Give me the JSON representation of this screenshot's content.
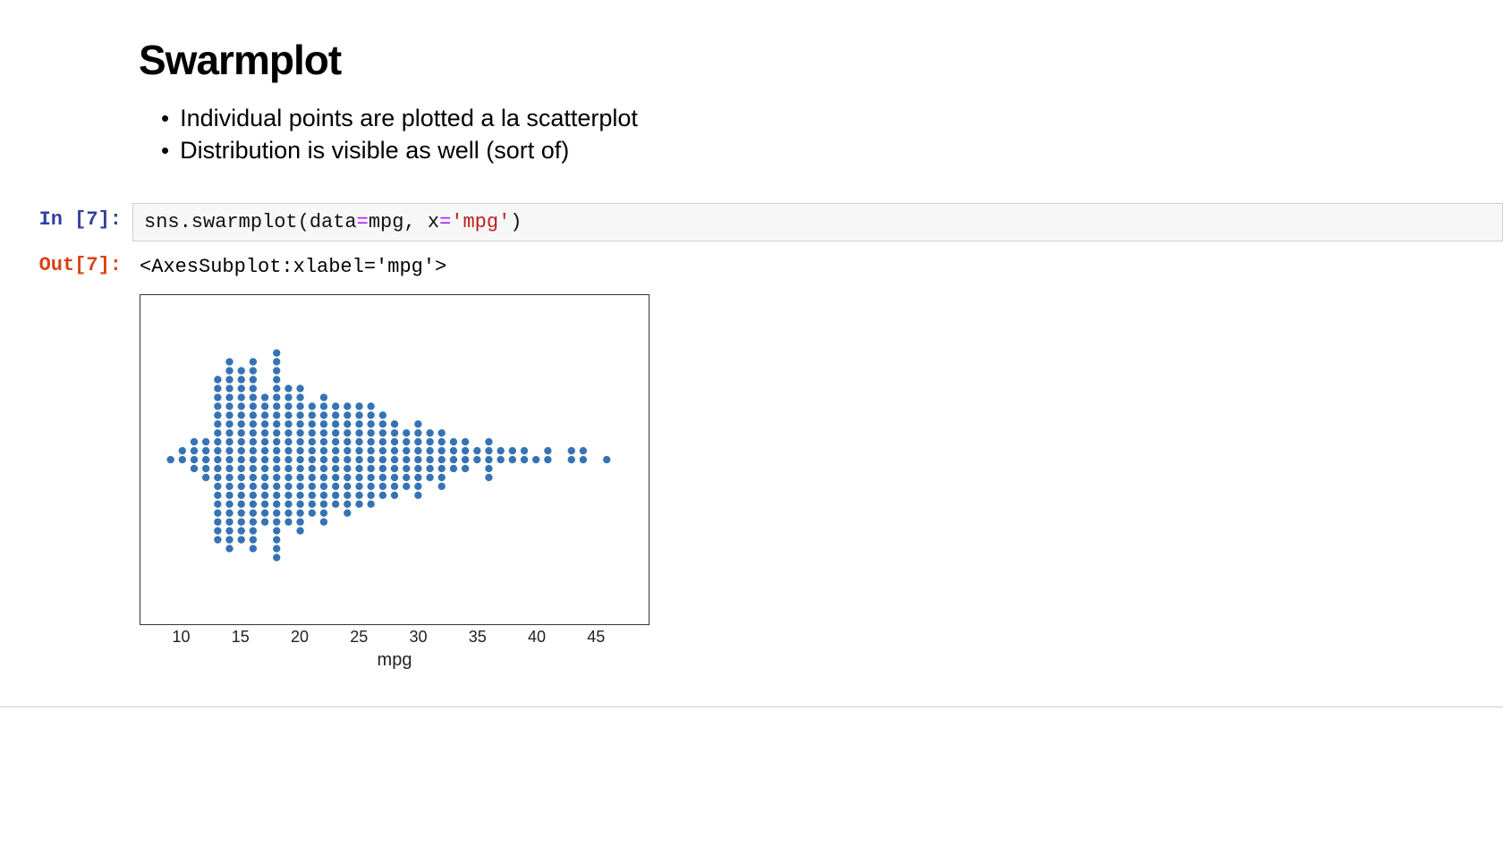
{
  "heading": "Swarmplot",
  "bullets": [
    "Individual points are plotted a la scatterplot",
    "Distribution is visible as well (sort of)"
  ],
  "cell": {
    "in_prompt": "In [7]:",
    "out_prompt": "Out[7]:",
    "code_parts": {
      "p1": "sns.swarmplot(data",
      "eq1": "=",
      "p2": "mpg, x",
      "eq2": "=",
      "str": "'mpg'",
      "p3": ")"
    },
    "output_text": "<AxesSubplot:xlabel='mpg'>"
  },
  "chart_data": {
    "type": "scatter",
    "title": "",
    "xlabel": "mpg",
    "ylabel": "",
    "xlim": [
      8,
      48
    ],
    "x_ticks": [
      10,
      15,
      20,
      25,
      30,
      35,
      40,
      45
    ],
    "x_tick_labels": [
      "10",
      "15",
      "20",
      "25",
      "30",
      "35",
      "40",
      "45"
    ],
    "point_color": "#2b6cb0",
    "values": [
      9,
      10,
      10,
      11,
      11,
      11,
      11,
      12,
      12,
      12,
      12,
      12,
      13,
      13,
      13,
      13,
      13,
      13,
      13,
      13,
      13,
      13,
      13,
      13,
      13,
      13,
      13,
      13,
      13,
      13,
      13,
      14,
      14,
      14,
      14,
      14,
      14,
      14,
      14,
      14,
      14,
      14,
      14,
      14,
      14,
      14,
      14,
      14,
      14,
      14,
      14,
      14,
      14,
      15,
      15,
      15,
      15,
      15,
      15,
      15,
      15,
      15,
      15,
      15,
      15,
      15,
      15,
      15,
      15,
      15,
      15,
      15,
      15,
      16,
      16,
      16,
      16,
      16,
      16,
      16,
      16,
      16,
      16,
      16,
      16,
      16,
      16,
      16,
      16,
      16,
      16,
      16,
      16,
      16,
      16,
      17,
      17,
      17,
      17,
      17,
      17,
      17,
      17,
      17,
      17,
      17,
      17,
      17,
      17,
      17,
      18,
      18,
      18,
      18,
      18,
      18,
      18,
      18,
      18,
      18,
      18,
      18,
      18,
      18,
      18,
      18,
      18,
      18,
      18,
      18,
      18,
      18,
      18,
      18,
      19,
      19,
      19,
      19,
      19,
      19,
      19,
      19,
      19,
      19,
      19,
      19,
      19,
      19,
      19,
      19,
      20,
      20,
      20,
      20,
      20,
      20,
      20,
      20,
      20,
      20,
      20,
      20,
      20,
      20,
      20,
      20,
      20,
      21,
      21,
      21,
      21,
      21,
      21,
      21,
      21,
      21,
      21,
      21,
      21,
      21,
      22,
      22,
      22,
      22,
      22,
      22,
      22,
      22,
      22,
      22,
      22,
      22,
      22,
      22,
      22,
      23,
      23,
      23,
      23,
      23,
      23,
      23,
      23,
      23,
      23,
      23,
      23,
      24,
      24,
      24,
      24,
      24,
      24,
      24,
      24,
      24,
      24,
      24,
      24,
      24,
      25,
      25,
      25,
      25,
      25,
      25,
      25,
      25,
      25,
      25,
      25,
      25,
      26,
      26,
      26,
      26,
      26,
      26,
      26,
      26,
      26,
      26,
      26,
      26,
      27,
      27,
      27,
      27,
      27,
      27,
      27,
      27,
      27,
      27,
      28,
      28,
      28,
      28,
      28,
      28,
      28,
      28,
      28,
      29,
      29,
      29,
      29,
      29,
      29,
      29,
      30,
      30,
      30,
      30,
      30,
      30,
      30,
      30,
      30,
      31,
      31,
      31,
      31,
      31,
      31,
      32,
      32,
      32,
      32,
      32,
      32,
      32,
      33,
      33,
      33,
      33,
      34,
      34,
      34,
      34,
      35,
      35,
      36,
      36,
      36,
      36,
      36,
      37,
      37,
      38,
      38,
      39,
      39,
      40,
      41,
      41,
      43,
      43,
      44,
      44,
      46
    ]
  }
}
